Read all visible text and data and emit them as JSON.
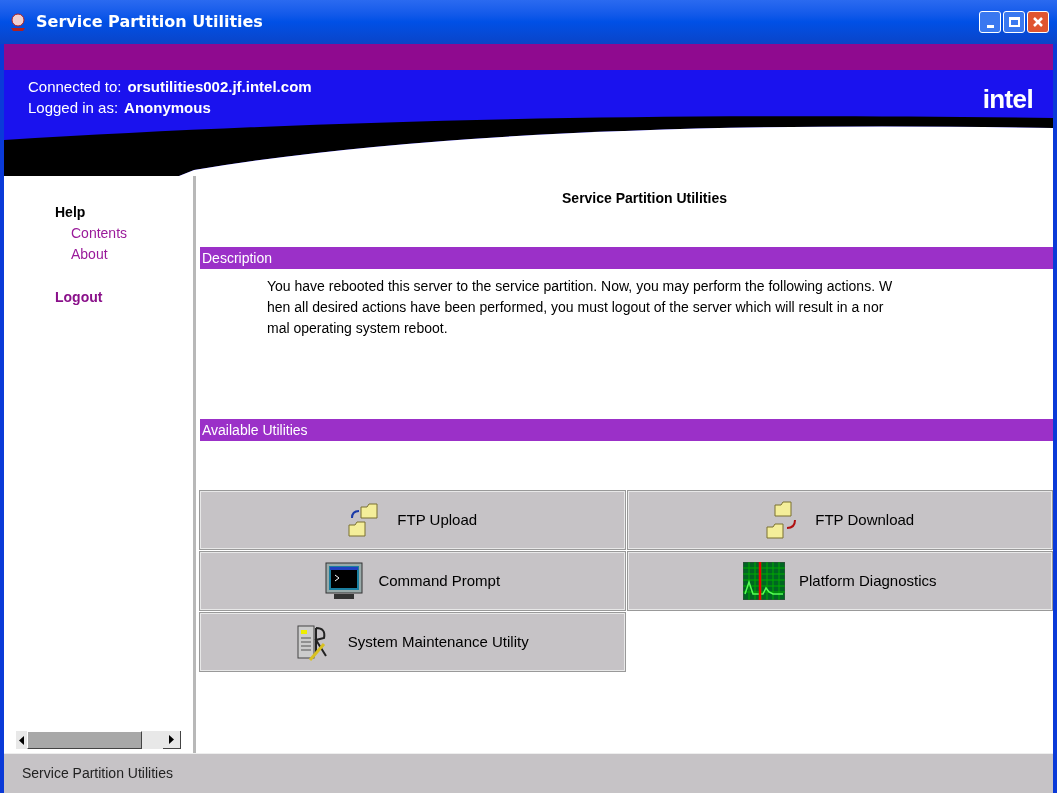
{
  "window": {
    "title": "Service Partition Utilities"
  },
  "header": {
    "connected_label": "Connected to:",
    "connected_value": "orsutilities002.jf.intel.com",
    "logged_label": "Logged in as:",
    "logged_value": "Anonymous",
    "logo": "intel"
  },
  "sidebar": {
    "sections": [
      {
        "kind": "heading",
        "label": "Help"
      },
      {
        "kind": "link",
        "label": "Contents"
      },
      {
        "kind": "link",
        "label": "About"
      },
      {
        "kind": "action",
        "label": "Logout"
      }
    ]
  },
  "main": {
    "title": "Service Partition Utilities",
    "description": {
      "heading": "Description",
      "lines": [
        "You have rebooted this server to the service partition. Now, you may perform the following actions. W",
        "hen all desired actions have been performed, you must logout of the server which will result in a nor",
        "mal operating system reboot."
      ]
    },
    "utilities": {
      "heading": "Available Utilities",
      "items": [
        {
          "kind": "upload",
          "label": "FTP Upload"
        },
        {
          "kind": "download",
          "label": "FTP Download"
        },
        {
          "kind": "prompt",
          "label": "Command Prompt"
        },
        {
          "kind": "diagnostics",
          "label": "Platform Diagnostics"
        },
        {
          "kind": "maintenance",
          "label": "System Maintenance Utility"
        }
      ]
    }
  },
  "status_bar": "Service Partition Utilities"
}
